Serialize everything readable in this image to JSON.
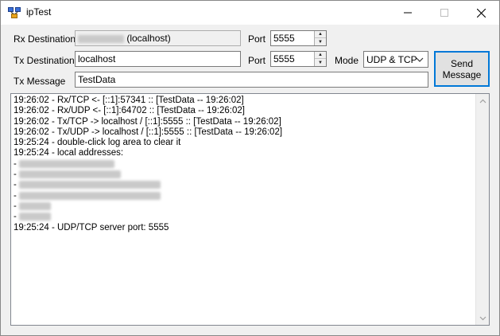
{
  "window": {
    "title": "ipTest"
  },
  "form": {
    "rx_destination_label": "Rx Destination",
    "rx_destination_suffix": "(localhost)",
    "rx_port_label": "Port",
    "rx_port_value": "5555",
    "tx_destination_label": "Tx Destination",
    "tx_destination_value": "localhost",
    "tx_port_label": "Port",
    "tx_port_value": "5555",
    "mode_label": "Mode",
    "mode_value": "UDP & TCP",
    "tx_message_label": "Tx Message",
    "tx_message_value": "TestData",
    "send_button_label": "Send\nMessage"
  },
  "log": {
    "lines": [
      "19:26:02 - Rx/TCP <- [::1]:57341 :: [TestData -- 19:26:02]",
      "19:26:02 - Rx/UDP <- [::1]:64702 :: [TestData -- 19:26:02]",
      "19:26:02 - Tx/TCP -> localhost / [::1]:5555 :: [TestData -- 19:26:02]",
      "19:26:02 - Tx/UDP -> localhost / [::1]:5555 :: [TestData -- 19:26:02]",
      "19:25:24 - double-click log area to clear it",
      "19:25:24 - local addresses:",
      " - ",
      " - ",
      " - ",
      " - ",
      " - ",
      " - ",
      "19:25:24 - UDP/TCP server port: 5555"
    ]
  },
  "icons": {
    "app": "network-app-icon",
    "minimize": "minimize-icon",
    "maximize": "maximize-icon",
    "close": "close-icon",
    "spin_up": "spin-up-arrow-icon",
    "spin_down": "spin-down-arrow-icon",
    "combo_arrow": "chevron-down-icon",
    "scroll_up": "scroll-up-arrow-icon",
    "scroll_down": "scroll-down-arrow-icon"
  },
  "colors": {
    "accent": "#0078d7",
    "window_bg": "#f0f0f0"
  }
}
